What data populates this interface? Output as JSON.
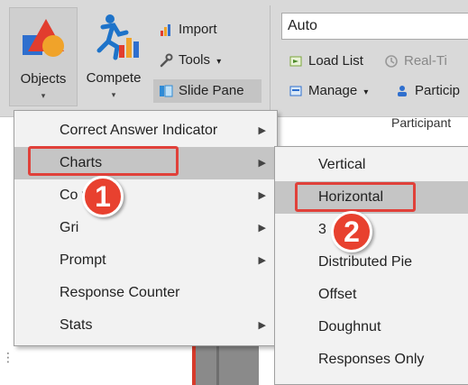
{
  "ribbon": {
    "objects_label": "Objects",
    "compete_label": "Compete",
    "import_label": "Import",
    "tools_label": "Tools",
    "slide_pane_label": "Slide Pane",
    "combo_value": "Auto",
    "load_list_label": "Load List",
    "real_time_label": "Real-Ti",
    "manage_label": "Manage",
    "participants_label": "Particip",
    "group_label": "Participant",
    "caret": "▾"
  },
  "menu": {
    "items": [
      {
        "label": "Correct Answer Indicator",
        "submenu": true
      },
      {
        "label": "Charts",
        "submenu": true
      },
      {
        "label": "Co        wn",
        "submenu": true
      },
      {
        "label": "Gri",
        "submenu": true
      },
      {
        "label": "Prompt",
        "submenu": true
      },
      {
        "label": "Response Counter",
        "submenu": false
      },
      {
        "label": "Stats",
        "submenu": true
      }
    ]
  },
  "submenu": {
    "items": [
      {
        "label": "Vertical"
      },
      {
        "label": "Horizontal"
      },
      {
        "label": "3"
      },
      {
        "label": "Distributed Pie"
      },
      {
        "label": "Offset"
      },
      {
        "label": "Doughnut"
      },
      {
        "label": "Responses Only"
      }
    ]
  },
  "callouts": {
    "first": "1",
    "second": "2"
  },
  "arrow_glyph": "▶",
  "side_mark": "⋮",
  "colors": {
    "accent_red": "#e0413a",
    "callout_red": "#e8412f",
    "ribbon_bg": "#d9d9d9",
    "menu_bg": "#f2f2f2",
    "highlight": "#c5c5c5"
  }
}
